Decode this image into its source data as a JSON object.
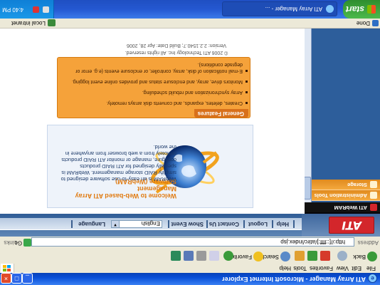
{
  "window": {
    "title": "ATI Array Manager - Microsoft Internet Explorer",
    "controls": {
      "minimize": "_",
      "maximize": "□",
      "close": "×"
    }
  },
  "menu": [
    "File",
    "Edit",
    "View",
    "Favorites",
    "Tools",
    "Help"
  ],
  "toolbar": {
    "back": "Back",
    "search": "Search",
    "favorites": "Favorites",
    "icons": [
      "forward-icon",
      "stop-icon",
      "refresh-icon",
      "home-icon",
      "history-icon",
      "mail-icon",
      "print-icon",
      "edit-icon",
      "messenger-icon"
    ]
  },
  "address": {
    "label": "Address",
    "url": "http://[::ffff:]/atirc/index.jsp",
    "go": "Go",
    "links": "Links"
  },
  "header": {
    "logo": "ATI",
    "nav": [
      "Help",
      "Logout",
      "Contact Us",
      "Show Event",
      "Language"
    ],
    "language_value": "English"
  },
  "sidebar": {
    "items": [
      "ATI WebRAM",
      "Administration Tools",
      "Storage"
    ]
  },
  "content": {
    "welcome_title_line1": "Welcome to Web-based ATI Array Management",
    "welcome_title_line2": "Software (WebRAM)",
    "welcome_lines": [
      "WebRAM is an easy-to-use software designed to",
      "simplify RAID storage management. WebRAM is",
      "specially designed for ATI RAID products",
      "configure, manage or monitor ATI RAID products",
      "remotely from a web browser from anywhere in",
      "the world."
    ],
    "features_title": "General Features",
    "features": [
      "Creates, deletes, expands, and converts disk arrays remotely.",
      "Array synchronization and rebuild scheduling.",
      "Monitors drive, array, and enclosure status and provides online event logging.",
      "E-mail notification of disk, array, controller, or enclosure events (e.g. error or degrade conditions)."
    ],
    "copyright": "© 2006 ATI Technology Inc. All rights reserved.",
    "version": "Version: 2.2.1540.7; Build Date: Apr 28, 2006"
  },
  "status": {
    "text": "Done",
    "zone": "Local intranet"
  },
  "taskbar": {
    "start": "start",
    "task": "ATI Array Manager - ...",
    "clock": "4:40 PM"
  }
}
